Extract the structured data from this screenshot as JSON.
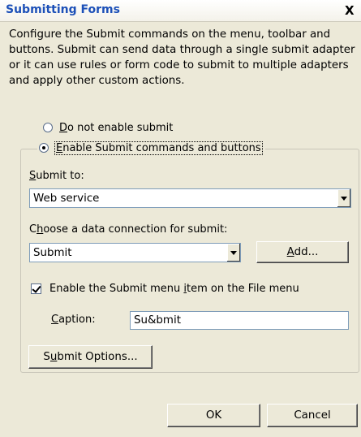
{
  "dialog": {
    "title": "Submitting Forms",
    "close_glyph": "X",
    "description": "Configure the Submit commands on the menu, toolbar and buttons. Submit can send data through a single submit adapter or it can use rules or form code to submit to multiple adapters and apply other custom actions."
  },
  "options": {
    "disable_submit": {
      "mnemonic": "D",
      "rest": "o not enable submit",
      "checked": false
    },
    "enable_submit": {
      "mnemonic": "E",
      "rest": "nable Submit commands and buttons",
      "checked": true
    }
  },
  "submit_to": {
    "label_mnemonic": "S",
    "label_rest": "ubmit to:",
    "value": "Web service"
  },
  "data_connection": {
    "label_before": "C",
    "label_mnemonic": "h",
    "label_rest": "oose a data connection for submit:",
    "value": "Submit",
    "add_mnemonic": "A",
    "add_rest": "dd..."
  },
  "menu_item": {
    "checked": true,
    "label_before": "Enable the Submit menu ",
    "label_mnemonic": "i",
    "label_rest": "tem on the File menu",
    "caption_mnemonic": "C",
    "caption_rest": "aption:",
    "caption_value": "Su&bmit"
  },
  "submit_options": {
    "before": "S",
    "mnemonic": "u",
    "rest": "bmit Options..."
  },
  "footer": {
    "ok": "OK",
    "cancel": "Cancel"
  }
}
